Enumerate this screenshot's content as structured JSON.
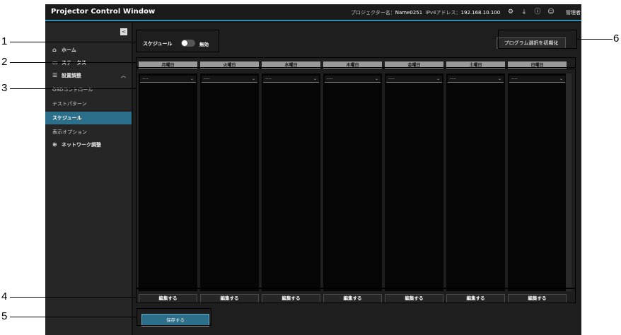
{
  "app": {
    "title": "Projector Control Window",
    "projector_name_label": "プロジェクター名：",
    "projector_name": "Name0251",
    "ipv4_label": "IPv4アドレス：",
    "ipv4": "192.168.10.100",
    "user_label": "管理者",
    "icons": {
      "settings": "gear-icon",
      "download": "download-icon",
      "info": "info-icon",
      "user": "user-icon"
    },
    "accent_color": "#2f8fb6"
  },
  "sidebar": {
    "collapse_icon": "<",
    "items": [
      {
        "label": "ホーム",
        "icon": "home-icon"
      },
      {
        "label": "ステータス",
        "icon": "status-icon"
      },
      {
        "label": "設置調整",
        "icon": "sliders-icon"
      },
      {
        "label": "OSDコントロール"
      },
      {
        "label": "テストパターン"
      },
      {
        "label": "スケジュール",
        "active": true
      },
      {
        "label": "表示オプション"
      },
      {
        "label": "ネットワーク調整",
        "icon": "globe-icon"
      }
    ],
    "active_color": "#2b6f8a"
  },
  "main": {
    "schedule_label": "スケジュール",
    "toggle_state": "無効",
    "init_button": "プログラム選択を初期化",
    "days": [
      "月曜日",
      "火曜日",
      "水曜日",
      "木曜日",
      "金曜日",
      "土曜日",
      "日曜日"
    ],
    "program_placeholder": "----",
    "edit_button": "編集する",
    "save_button": "保存する"
  },
  "callouts": [
    "1",
    "2",
    "3",
    "4",
    "5",
    "6"
  ]
}
